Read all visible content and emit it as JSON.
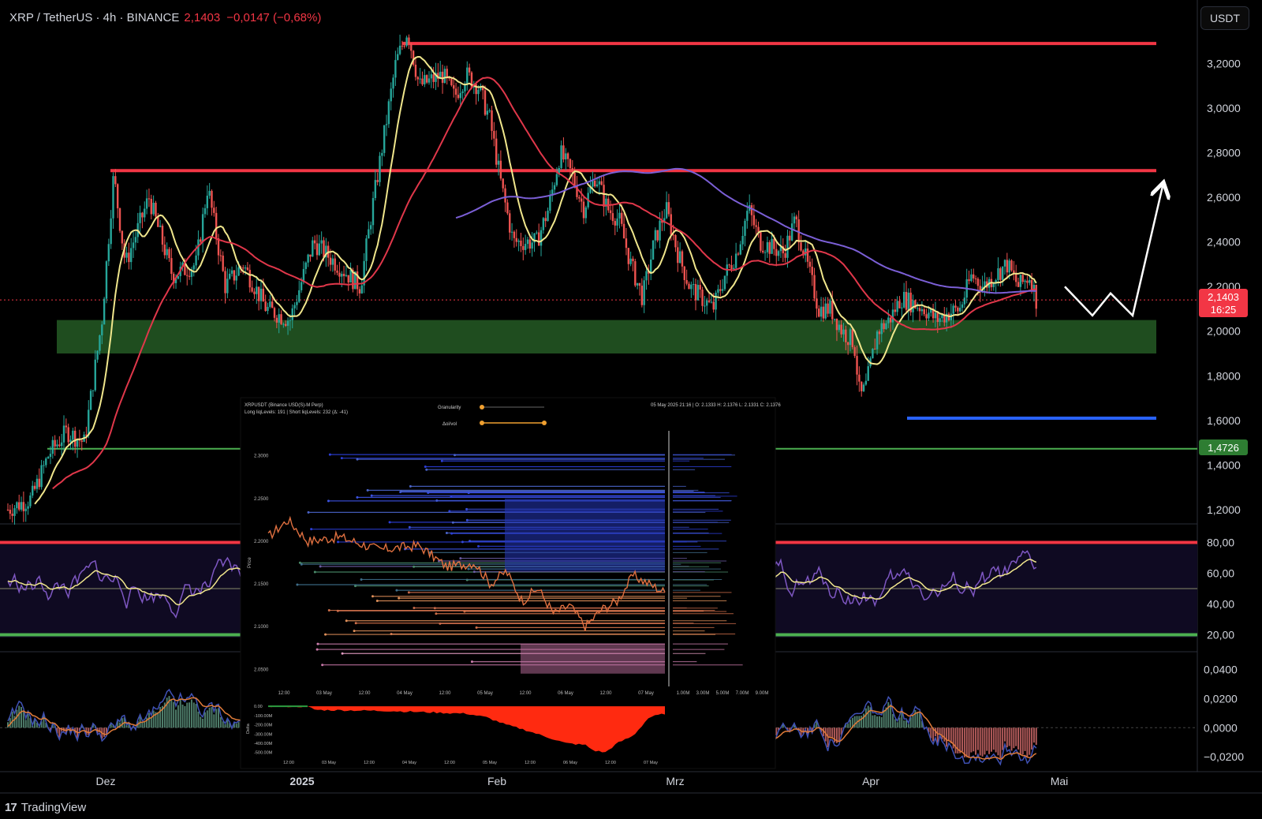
{
  "header": {
    "symbol": "XRP / TetherUS · 4h · BINANCE",
    "price": "2,1403",
    "change": "−0,0147 (−0,68%)"
  },
  "unit_button": "USDT",
  "price_tags": {
    "current_price": "2,1403",
    "countdown": "16:25",
    "green_level": "1,4726"
  },
  "brand": "TradingView",
  "colors": {
    "up": "#26a69a",
    "down": "#ef5350",
    "yellow": "#f0e68c",
    "red_ma": "#e0374a",
    "purple_ma": "#7b5fd6",
    "resistance": "#f23645",
    "support_zone": "#1f4d1f",
    "blue_line": "#2962ff",
    "green_line": "#4caf50"
  },
  "chart_data": [
    {
      "type": "candlestick",
      "series": [
        {
          "name": "",
          "color": "yellow",
          "kind": "short moving average"
        },
        {
          "name": "",
          "color": "red",
          "kind": "medium moving average"
        },
        {
          "name": "",
          "color": "purple",
          "kind": "long moving average"
        }
      ],
      "x_tick_labels": [
        "Dez",
        "2025",
        "Feb",
        "Mrz",
        "Apr",
        "Mai"
      ],
      "y_tick_labels": [
        "3,2000",
        "3,0000",
        "2,8000",
        "2,6000",
        "2,4000",
        "2,2000",
        "2,0000",
        "1,8000",
        "1,6000",
        "1,4000",
        "1,2000"
      ],
      "ylim": [
        1.15,
        3.4
      ],
      "log_scale": false,
      "grid": false,
      "price_path": [
        [
          0.0,
          1.2
        ],
        [
          0.02,
          1.25
        ],
        [
          0.035,
          1.45
        ],
        [
          0.05,
          1.55
        ],
        [
          0.065,
          1.5
        ],
        [
          0.08,
          2.05
        ],
        [
          0.09,
          2.7
        ],
        [
          0.1,
          2.3
        ],
        [
          0.12,
          2.6
        ],
        [
          0.14,
          2.25
        ],
        [
          0.16,
          2.3
        ],
        [
          0.17,
          2.65
        ],
        [
          0.185,
          2.2
        ],
        [
          0.2,
          2.3
        ],
        [
          0.22,
          2.1
        ],
        [
          0.24,
          2.05
        ],
        [
          0.26,
          2.4
        ],
        [
          0.28,
          2.3
        ],
        [
          0.3,
          2.2
        ],
        [
          0.31,
          2.55
        ],
        [
          0.33,
          3.2
        ],
        [
          0.34,
          3.35
        ],
        [
          0.35,
          3.1
        ],
        [
          0.37,
          3.15
        ],
        [
          0.38,
          3.05
        ],
        [
          0.39,
          3.15
        ],
        [
          0.4,
          3.1
        ],
        [
          0.41,
          2.95
        ],
        [
          0.42,
          2.65
        ],
        [
          0.43,
          2.4
        ],
        [
          0.45,
          2.4
        ],
        [
          0.46,
          2.55
        ],
        [
          0.47,
          2.8
        ],
        [
          0.48,
          2.7
        ],
        [
          0.49,
          2.55
        ],
        [
          0.5,
          2.7
        ],
        [
          0.51,
          2.55
        ],
        [
          0.52,
          2.5
        ],
        [
          0.53,
          2.3
        ],
        [
          0.54,
          2.15
        ],
        [
          0.55,
          2.4
        ],
        [
          0.56,
          2.55
        ],
        [
          0.57,
          2.35
        ],
        [
          0.58,
          2.2
        ],
        [
          0.6,
          2.1
        ],
        [
          0.61,
          2.25
        ],
        [
          0.62,
          2.35
        ],
        [
          0.63,
          2.55
        ],
        [
          0.64,
          2.4
        ],
        [
          0.66,
          2.35
        ],
        [
          0.67,
          2.5
        ],
        [
          0.68,
          2.3
        ],
        [
          0.69,
          2.1
        ],
        [
          0.7,
          2.1
        ],
        [
          0.71,
          2.0
        ],
        [
          0.72,
          1.95
        ],
        [
          0.725,
          1.7
        ],
        [
          0.73,
          1.75
        ],
        [
          0.74,
          2.0
        ],
        [
          0.75,
          2.05
        ],
        [
          0.76,
          2.15
        ],
        [
          0.78,
          2.1
        ],
        [
          0.79,
          2.05
        ],
        [
          0.8,
          2.08
        ],
        [
          0.81,
          2.1
        ],
        [
          0.82,
          2.25
        ],
        [
          0.83,
          2.2
        ],
        [
          0.84,
          2.25
        ],
        [
          0.85,
          2.3
        ],
        [
          0.86,
          2.2
        ],
        [
          0.87,
          2.25
        ],
        [
          0.875,
          2.14
        ]
      ],
      "support_zone": [
        1.9,
        2.05
      ],
      "resistance_levels": [
        3.29,
        2.72
      ],
      "support_line_blue": 1.61,
      "green_line_level": 1.4726,
      "current_price": 2.1403,
      "projection_path": [
        2.2,
        2.07,
        2.17,
        2.07,
        2.65
      ]
    },
    {
      "type": "line",
      "indicator": "oscillator",
      "y_tick_labels": [
        "80,00",
        "60,00",
        "40,00",
        "20,00"
      ],
      "ylim": [
        10,
        90
      ],
      "levels": [
        80,
        50,
        20
      ]
    },
    {
      "type": "bar",
      "indicator": "histogram oscillator",
      "y_tick_labels": [
        "0,0400",
        "0,0200",
        "0,0000",
        "−0,0200"
      ],
      "ylim": [
        -0.028,
        0.05
      ]
    },
    {
      "type": "scatter",
      "inset": true,
      "title": "XRPUSDT (Binance USD(S)-M Perp)",
      "subtitle": "Long liqLevels: 191 | Short liqLevels: 232 (Δ: -41)",
      "ohlc_info": "05 May 2025 21:16 | O: 2.1333 H: 2.1376 L: 2.1331 C: 2.1376",
      "controls": [
        "Granularity",
        "Δoi/vol"
      ],
      "ylabel": "Price",
      "y_tick_labels": [
        "2.3000",
        "2.2500",
        "2.2000",
        "2.1500",
        "2.1000",
        "2.0500"
      ],
      "x_tick_labels": [
        "12:00",
        "03 May",
        "12:00",
        "04 May",
        "12:00",
        "05 May",
        "12:00",
        "06 May",
        "12:00",
        "07 May"
      ],
      "volume_tick_labels": [
        "1.00M",
        "3.00M",
        "5.00M",
        "7.00M",
        "9.00M"
      ],
      "ylim": [
        2.03,
        2.32
      ]
    },
    {
      "type": "area",
      "inset": true,
      "ylabel": "Delta",
      "y_tick_labels": [
        "0.00",
        "-100.00M",
        "-200.00M",
        "-300.00M",
        "-400.00M",
        "-500.00M"
      ],
      "x_tick_labels": [
        "12:00",
        "03 May",
        "12:00",
        "04 May",
        "12:00",
        "05 May",
        "12:00",
        "06 May",
        "12:00",
        "07 May"
      ],
      "ylim": [
        -520,
        10
      ]
    }
  ]
}
